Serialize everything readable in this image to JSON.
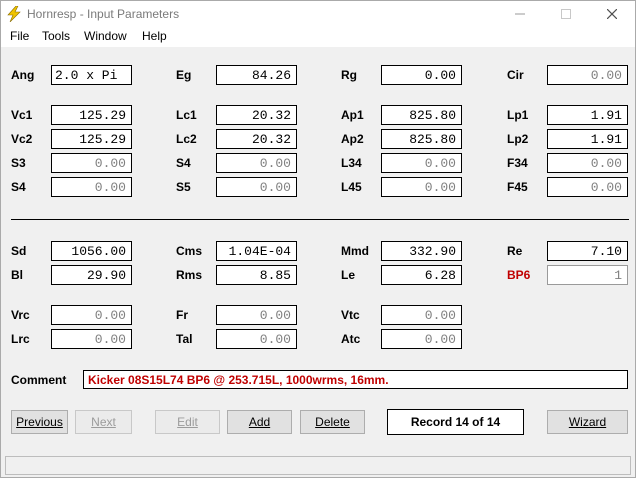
{
  "window": {
    "title": "Hornresp - Input Parameters",
    "icon": "lightning-icon",
    "accent_color": "#f0c400"
  },
  "menu": {
    "file": "File",
    "tools": "Tools",
    "window": "Window",
    "help": "Help"
  },
  "params": {
    "ang": {
      "label": "Ang",
      "value": "2.0 x Pi"
    },
    "eg": {
      "label": "Eg",
      "value": "84.26"
    },
    "rg": {
      "label": "Rg",
      "value": "0.00"
    },
    "cir": {
      "label": "Cir",
      "value": "0.00"
    },
    "vc1": {
      "label": "Vc1",
      "value": "125.29"
    },
    "lc1": {
      "label": "Lc1",
      "value": "20.32"
    },
    "ap1": {
      "label": "Ap1",
      "value": "825.80"
    },
    "lp1": {
      "label": "Lp1",
      "value": "1.91"
    },
    "vc2": {
      "label": "Vc2",
      "value": "125.29"
    },
    "lc2": {
      "label": "Lc2",
      "value": "20.32"
    },
    "ap2": {
      "label": "Ap2",
      "value": "825.80"
    },
    "lp2": {
      "label": "Lp2",
      "value": "1.91"
    },
    "s3": {
      "label": "S3",
      "value": "0.00"
    },
    "s4a": {
      "label": "S4",
      "value": "0.00"
    },
    "l34": {
      "label": "L34",
      "value": "0.00"
    },
    "f34": {
      "label": "F34",
      "value": "0.00"
    },
    "s4b": {
      "label": "S4",
      "value": "0.00"
    },
    "s5": {
      "label": "S5",
      "value": "0.00"
    },
    "l45": {
      "label": "L45",
      "value": "0.00"
    },
    "f45": {
      "label": "F45",
      "value": "0.00"
    },
    "sd": {
      "label": "Sd",
      "value": "1056.00"
    },
    "cms": {
      "label": "Cms",
      "value": "1.04E-04"
    },
    "mmd": {
      "label": "Mmd",
      "value": "332.90"
    },
    "re": {
      "label": "Re",
      "value": "7.10"
    },
    "bl": {
      "label": "Bl",
      "value": "29.90"
    },
    "rms": {
      "label": "Rms",
      "value": "8.85"
    },
    "le": {
      "label": "Le",
      "value": "6.28"
    },
    "bp6": {
      "label": "BP6",
      "value": "1"
    },
    "vrc": {
      "label": "Vrc",
      "value": "0.00"
    },
    "fr": {
      "label": "Fr",
      "value": "0.00"
    },
    "vtc": {
      "label": "Vtc",
      "value": "0.00"
    },
    "lrc": {
      "label": "Lrc",
      "value": "0.00"
    },
    "tal": {
      "label": "Tal",
      "value": "0.00"
    },
    "atc": {
      "label": "Atc",
      "value": "0.00"
    }
  },
  "comment": {
    "label": "Comment",
    "value": "Kicker 08S15L74 BP6 @ 253.715L, 1000wrms, 16mm."
  },
  "buttons": {
    "previous": "Previous",
    "next": "Next",
    "edit": "Edit",
    "add": "Add",
    "delete": "Delete",
    "record": "Record 14 of 14",
    "wizard": "Wizard"
  },
  "colors": {
    "highlight_red": "#c00000"
  }
}
